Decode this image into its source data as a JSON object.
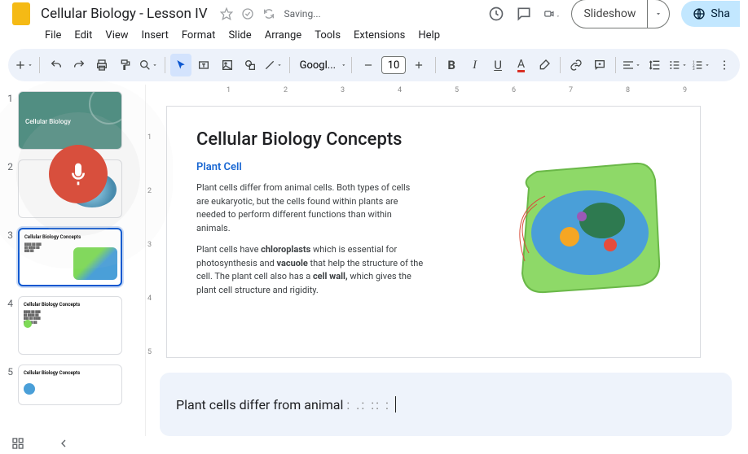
{
  "header": {
    "title": "Cellular Biology - Lesson IV",
    "saving": "Saving...",
    "slideshow": "Slideshow",
    "share": "Sha"
  },
  "menu": [
    "File",
    "Edit",
    "View",
    "Insert",
    "Format",
    "Slide",
    "Arrange",
    "Tools",
    "Extensions",
    "Help"
  ],
  "toolbar": {
    "font_name": "Googl...",
    "font_size": "10"
  },
  "ruler_h": [
    "1",
    "2",
    "3",
    "4",
    "5",
    "6",
    "7",
    "8",
    "9"
  ],
  "ruler_v": [
    "1",
    "2",
    "3",
    "4",
    "5"
  ],
  "slides": [
    {
      "num": "1",
      "title": "Cellular Biology"
    },
    {
      "num": "2",
      "title": ""
    },
    {
      "num": "3",
      "title": "Cellular Biology Concepts"
    },
    {
      "num": "4",
      "title": "Cellular Biology Concepts"
    },
    {
      "num": "5",
      "title": "Cellular Biology Concepts"
    }
  ],
  "slide": {
    "title": "Cellular Biology Concepts",
    "subtitle": "Plant Cell",
    "para1": "Plant cells differ from animal cells. Both types of cells are eukaryotic, but the cells found within plants are needed to perform different functions than within animals.",
    "para2_a": "Plant cells have ",
    "para2_b": "chloroplasts",
    "para2_c": " which is essential for photosynthesis and ",
    "para2_d": "vacuole",
    "para2_e": " that help the structure of the cell. The plant cell also has a ",
    "para2_f": "cell wall,",
    "para2_g": " which gives the plant cell structure and rigidity."
  },
  "caption": {
    "text": "Plant cells differ from animal",
    "dots": ": .: :: :"
  }
}
